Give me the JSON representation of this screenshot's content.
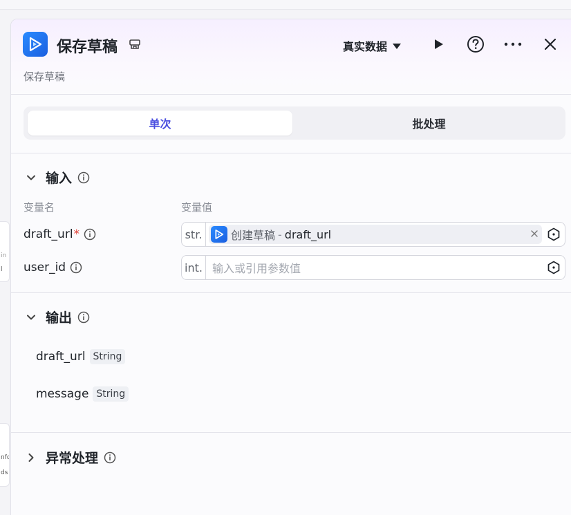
{
  "background": {
    "card_a_lines": [
      "in",
      "l"
    ],
    "card_b_lines": [
      "nfo",
      "ds"
    ]
  },
  "header": {
    "title": "保存草稿",
    "description": "保存草稿",
    "mode_label": "真实数据",
    "accent_color": "#4b4fe0"
  },
  "tabs": [
    {
      "label": "单次",
      "active": true
    },
    {
      "label": "批处理",
      "active": false
    }
  ],
  "input_section": {
    "title": "输入",
    "col_name": "变量名",
    "col_value": "变量值",
    "params": [
      {
        "name": "draft_url",
        "required_mark": "*",
        "type": "str.",
        "ref_node": "创建草稿",
        "ref_sep": "-",
        "ref_var": "draft_url"
      },
      {
        "name": "user_id",
        "type": "int.",
        "placeholder": "输入或引用参数值"
      }
    ]
  },
  "output_section": {
    "title": "输出",
    "fields": [
      {
        "name": "draft_url",
        "type": "String"
      },
      {
        "name": "message",
        "type": "String"
      }
    ]
  },
  "exception_section": {
    "title": "异常处理"
  }
}
